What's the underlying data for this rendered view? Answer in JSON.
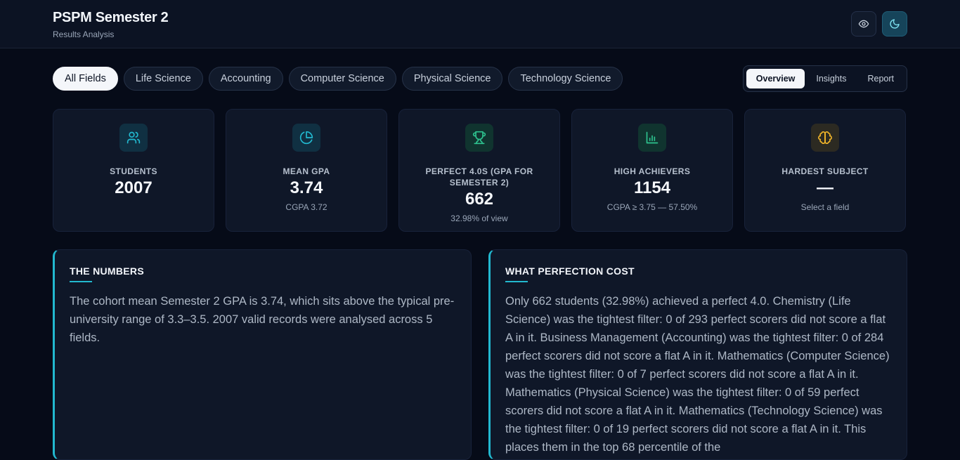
{
  "header": {
    "title": "PSPM Semester 2",
    "subtitle": "Results Analysis",
    "actions": [
      {
        "icon": "eye-icon"
      },
      {
        "icon": "moon-icon",
        "active": true
      }
    ]
  },
  "filters": [
    {
      "label": "All Fields",
      "active": true
    },
    {
      "label": "Life Science"
    },
    {
      "label": "Accounting"
    },
    {
      "label": "Computer Science"
    },
    {
      "label": "Physical Science"
    },
    {
      "label": "Technology Science"
    }
  ],
  "views": [
    {
      "label": "Overview",
      "active": true
    },
    {
      "label": "Insights"
    },
    {
      "label": "Report"
    }
  ],
  "stats": [
    {
      "icon": "users-icon",
      "color": "#22b8cf",
      "icon_bg": "#103042",
      "label": "Students",
      "value": "2007",
      "sub": ""
    },
    {
      "icon": "pie-chart-icon",
      "color": "#22b8cf",
      "icon_bg": "#103042",
      "label": "Mean GPA",
      "value": "3.74",
      "sub": "CGPA 3.72"
    },
    {
      "icon": "trophy-icon",
      "color": "#2ec38f",
      "icon_bg": "#10342f",
      "label": "Perfect 4.0s (GPA for Semester 2)",
      "value": "662",
      "sub": "32.98% of view"
    },
    {
      "icon": "bar-chart-icon",
      "color": "#2ec38f",
      "icon_bg": "#10342f",
      "label": "High Achievers",
      "value": "1154",
      "sub": "CGPA ≥ 3.75 — 57.50%"
    },
    {
      "icon": "brain-icon",
      "color": "#f0b429",
      "icon_bg": "#2c2a22",
      "label": "Hardest Subject",
      "value": "—",
      "sub": "Select a field"
    }
  ],
  "panels": {
    "numbers": {
      "title": "The Numbers",
      "body": "The cohort mean Semester 2 GPA is 3.74, which sits above the typical pre-university range of 3.3–3.5. 2007 valid records were analysed across 5 fields."
    },
    "perfection": {
      "title": "What Perfection Cost",
      "body": "Only 662 students (32.98%) achieved a perfect 4.0. Chemistry (Life Science) was the tightest filter: 0 of 293 perfect scorers did not score a flat A in it. Business Management (Accounting) was the tightest filter: 0 of 284 perfect scorers did not score a flat A in it. Mathematics (Computer Science) was the tightest filter: 0 of 7 perfect scorers did not score a flat A in it. Mathematics (Physical Science) was the tightest filter: 0 of 59 perfect scorers did not score a flat A in it. Mathematics (Technology Science) was the tightest filter: 0 of 19 perfect scorers did not score a flat A in it. This places them in the top 68 percentile of the"
    }
  }
}
